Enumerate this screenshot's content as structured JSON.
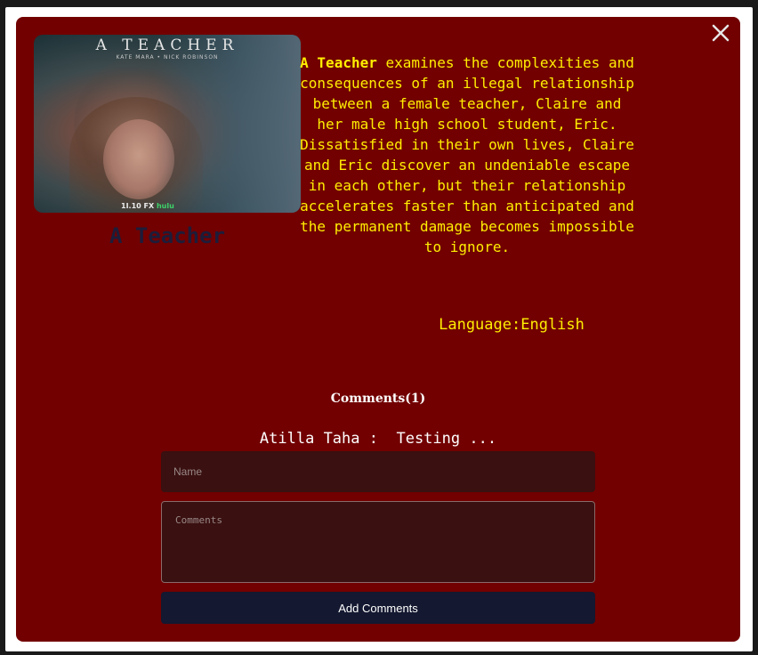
{
  "movie": {
    "poster_title": "A TEACHER",
    "poster_cast": "KATE MARA  •  NICK ROBINSON",
    "poster_network": "1I.10 FX",
    "poster_network_hulu": "hulu",
    "title": "A Teacher",
    "description_bold": "A Teacher",
    "description_rest": " examines the complexities and consequences of an illegal relationship between a female teacher, Claire and her male high school student, Eric. Dissatisfied in their own lives, Claire and Eric discover an undeniable escape in each other, but their relationship accelerates faster than anticipated and the permanent damage becomes impossible to ignore.",
    "language_label": "Language:",
    "language_value": "English"
  },
  "comments": {
    "heading": "Comments(1)",
    "items": [
      {
        "author": "Atilla Taha",
        "separator": " :  ",
        "text": "Testing ..."
      }
    ]
  },
  "form": {
    "name_placeholder": "Name",
    "comments_placeholder": "Comments",
    "submit_label": "Add Comments"
  },
  "icons": {
    "close": "close-icon"
  },
  "colors": {
    "modal_background": "#720000",
    "description_text": "#ffee00",
    "title_text": "#1d1d3a",
    "input_background": "#3a1010",
    "button_background": "#141830"
  }
}
